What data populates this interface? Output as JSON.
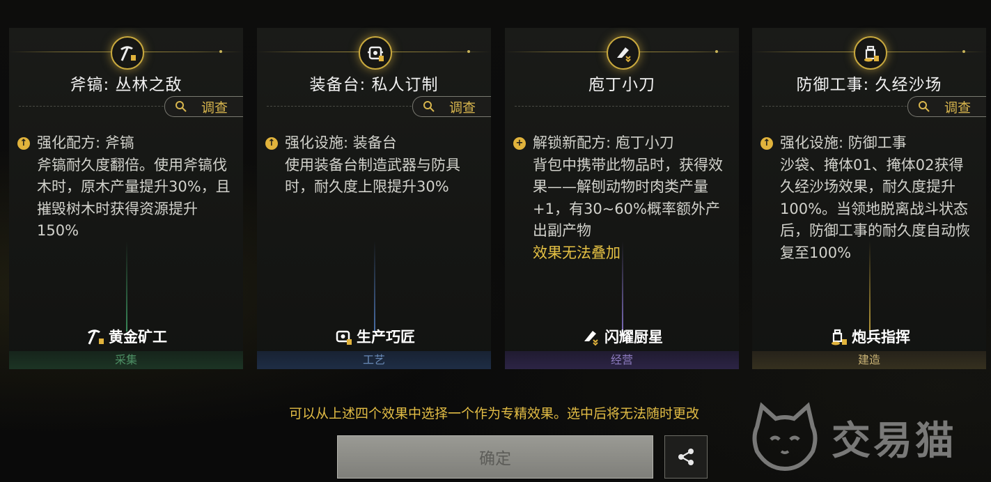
{
  "cards": [
    {
      "title": "斧镐: 丛林之敌",
      "investigate": "调查",
      "effect_head": "强化配方: 斧镐",
      "effect_body": "斧镐耐久度翻倍。使用斧镐伐木时，原木产量提升30%，且摧毁树木时获得资源提升150%",
      "warn": "",
      "role": "黄金矿工",
      "category": "采集",
      "icon": "pickaxe-icon",
      "head_icon": "upgrade-icon",
      "accent": "#3c7a52",
      "footer_color": "#4d8f64"
    },
    {
      "title": "装备台: 私人订制",
      "investigate": "调查",
      "effect_head": "强化设施: 装备台",
      "effect_body": "使用装备台制造武器与防具时，耐久度上限提升30%",
      "warn": "",
      "role": "生产巧匠",
      "category": "工艺",
      "icon": "workbench-icon",
      "head_icon": "upgrade-icon",
      "accent": "#3a5c8a",
      "footer_color": "#6a8bb8"
    },
    {
      "title": "庖丁小刀",
      "investigate": "",
      "effect_head": "解锁新配方: 庖丁小刀",
      "effect_body": "背包中携带此物品时，获得效果——解刨动物时肉类产量+1，有30~60%概率额外产出副产物",
      "warn": "效果无法叠加",
      "role": "闪耀厨星",
      "category": "经营",
      "icon": "knife-icon",
      "head_icon": "unlock-icon",
      "accent": "#55447f",
      "footer_color": "#8d7bc0"
    },
    {
      "title": "防御工事: 久经沙场",
      "investigate": "调查",
      "effect_head": "强化设施: 防御工事",
      "effect_body": "沙袋、掩体01、掩体02获得久经沙场效果，耐久度提升100%。当领地脱离战斗状态后，防御工事的耐久度自动恢复至100%",
      "warn": "",
      "role": "炮兵指挥",
      "category": "建造",
      "icon": "fortification-icon",
      "head_icon": "upgrade-icon",
      "accent": "#7a6a2a",
      "footer_color": "#c9b274"
    }
  ],
  "hint": "可以从上述四个效果中选择一个作为专精效果。选中后将无法随时更改",
  "confirm_label": "确定",
  "watermark": "交易猫",
  "accent_gold": "#e3bd45"
}
